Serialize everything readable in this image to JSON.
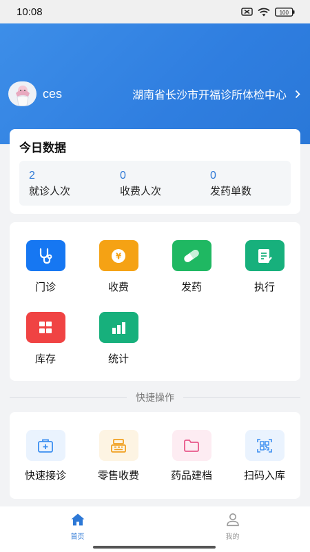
{
  "status_bar": {
    "time": "10:08",
    "battery": "100"
  },
  "header": {
    "user_name": "ces",
    "clinic_name": "湖南省长沙市开福诊所体检中心",
    "accent_color": "#2f7ee0"
  },
  "today": {
    "title": "今日数据",
    "stats": [
      {
        "value": "2",
        "label": "就诊人次"
      },
      {
        "value": "0",
        "label": "收费人次"
      },
      {
        "value": "0",
        "label": "发药单数"
      }
    ]
  },
  "menu": {
    "items": [
      {
        "label": "门诊",
        "icon": "stethoscope-icon",
        "color": "#1677f2"
      },
      {
        "label": "收费",
        "icon": "yen-coin-icon",
        "color": "#f5a214"
      },
      {
        "label": "发药",
        "icon": "pill-icon",
        "color": "#1fb862"
      },
      {
        "label": "执行",
        "icon": "checklist-icon",
        "color": "#17b07c"
      },
      {
        "label": "库存",
        "icon": "grid-icon",
        "color": "#f04343"
      },
      {
        "label": "统计",
        "icon": "bar-chart-icon",
        "color": "#17b07c"
      }
    ]
  },
  "quick": {
    "title": "快捷操作",
    "items": [
      {
        "label": "快速接诊",
        "icon": "medical-kit-icon",
        "color": "#3b8ef0",
        "bg": "#eaf3fe"
      },
      {
        "label": "零售收费",
        "icon": "cash-register-icon",
        "color": "#f0a020",
        "bg": "#fdf4e3"
      },
      {
        "label": "药品建档",
        "icon": "folder-icon",
        "color": "#e8588a",
        "bg": "#fdecf2"
      },
      {
        "label": "扫码入库",
        "icon": "qr-scan-icon",
        "color": "#3b8ef0",
        "bg": "#eaf3fe"
      }
    ]
  },
  "tabs": [
    {
      "label": "首页",
      "icon": "home-icon",
      "active": true
    },
    {
      "label": "我的",
      "icon": "user-icon",
      "active": false
    }
  ]
}
